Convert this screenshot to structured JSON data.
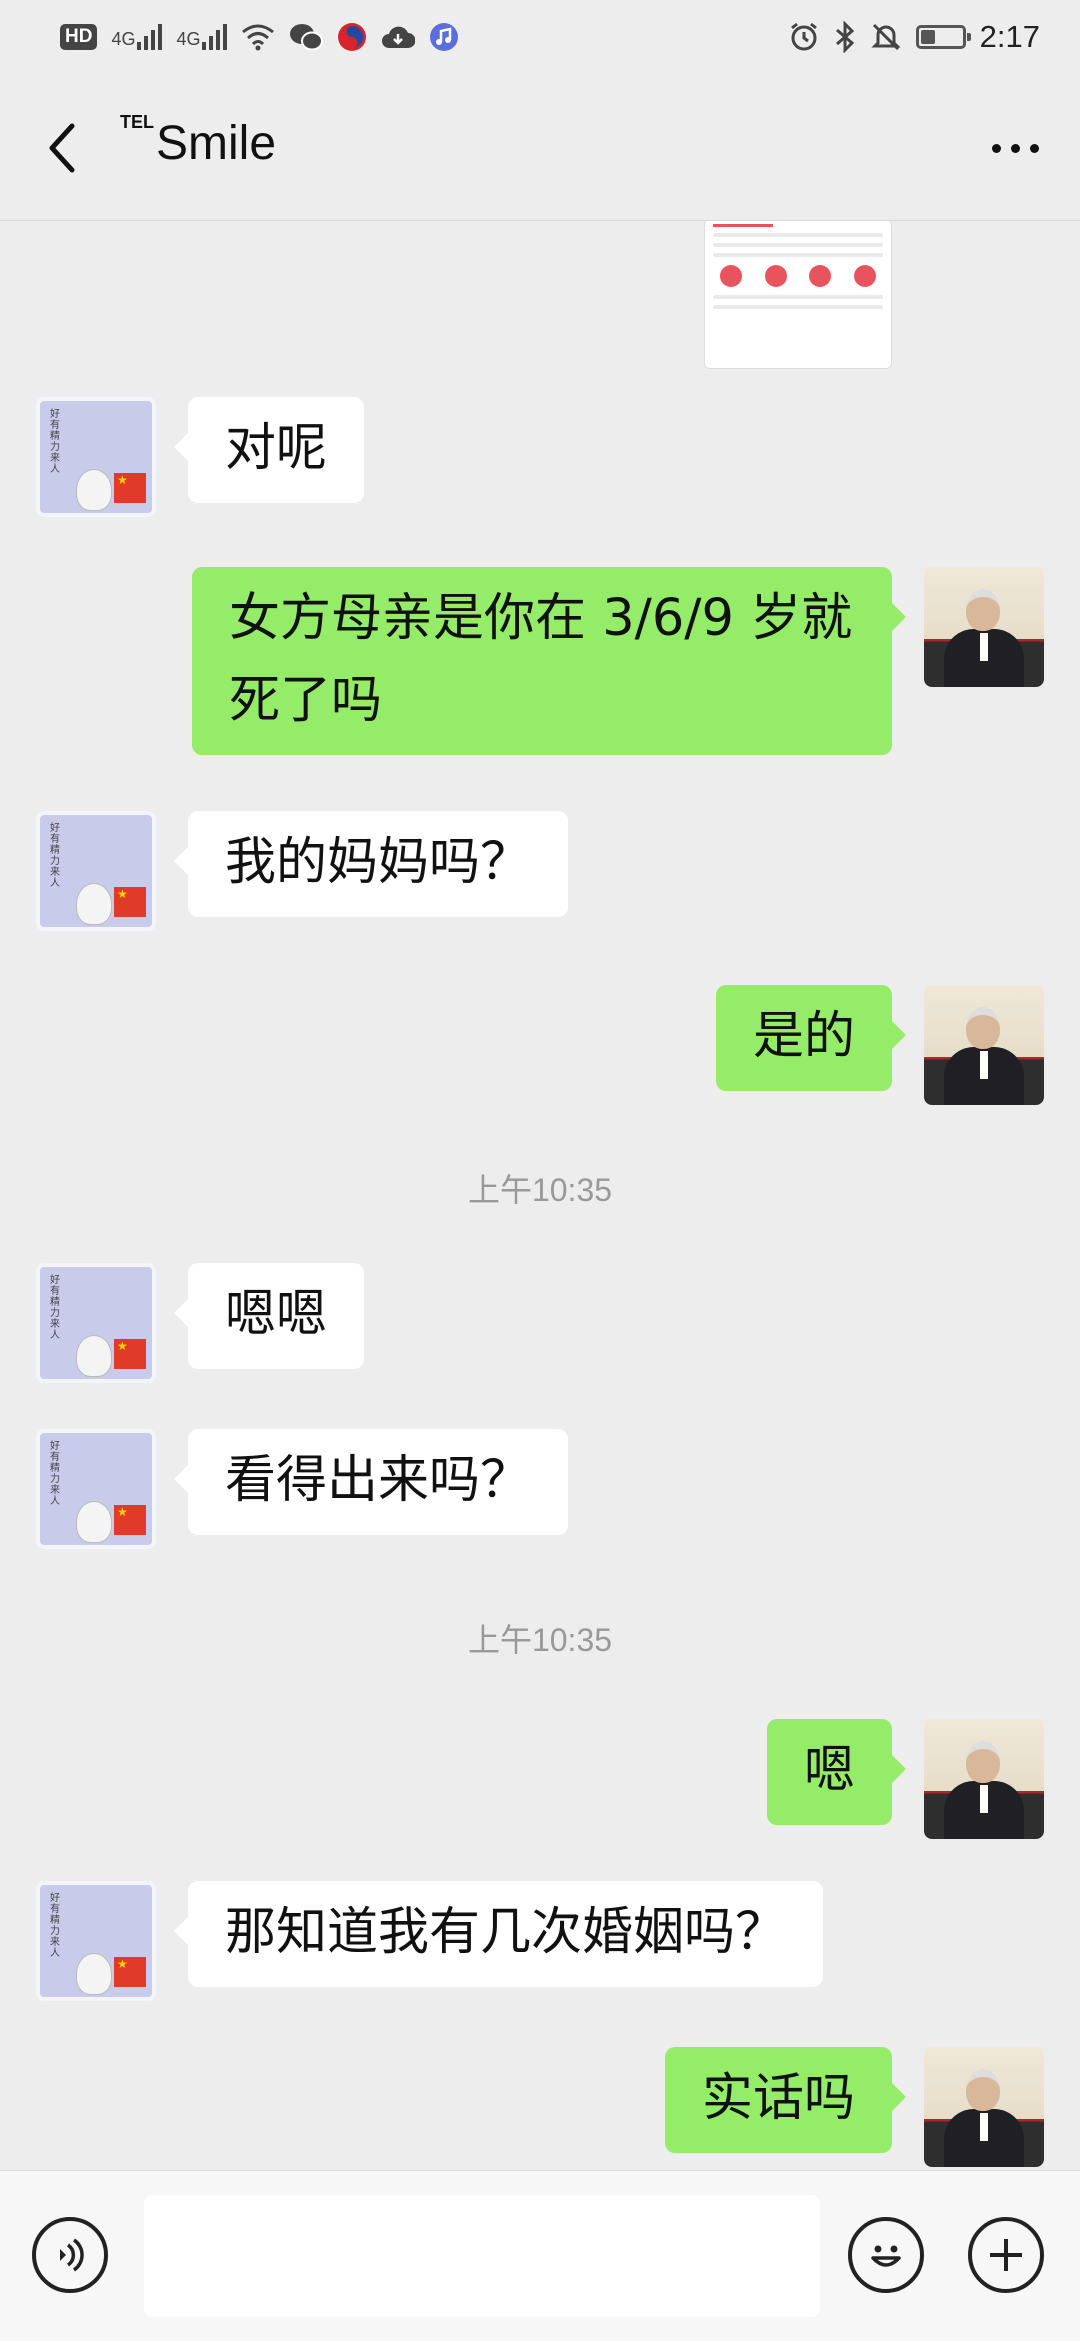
{
  "status_bar": {
    "hd": "HD",
    "sim1": "4G",
    "sim2": "4G",
    "time": "2:17",
    "battery_level": 0.35
  },
  "header": {
    "title_prefix": "TEL",
    "title": "Smile"
  },
  "messages": [
    {
      "side": "left",
      "text": "对呢"
    },
    {
      "side": "right",
      "text": "女方母亲是你在 3/6/9 岁就死了吗"
    },
    {
      "side": "left",
      "text": "我的妈妈吗？"
    },
    {
      "side": "right",
      "text": "是的"
    },
    {
      "side": "time",
      "text": "上午10:35"
    },
    {
      "side": "left",
      "text": "嗯嗯"
    },
    {
      "side": "left",
      "text": "看得出来吗？"
    },
    {
      "side": "time",
      "text": "上午10:35"
    },
    {
      "side": "right",
      "text": "嗯"
    },
    {
      "side": "left",
      "text": "那知道我有几次婚姻吗？"
    },
    {
      "side": "right",
      "text": "实话吗"
    }
  ],
  "avatar_other_text": "好有精力来人",
  "input": {
    "value": "",
    "placeholder": ""
  },
  "colors": {
    "self_bubble": "#95ec69",
    "other_bubble": "#ffffff",
    "background": "#ededed"
  },
  "icons": [
    "back-arrow-icon",
    "more-icon",
    "voice-icon",
    "emoji-icon",
    "plus-icon"
  ]
}
